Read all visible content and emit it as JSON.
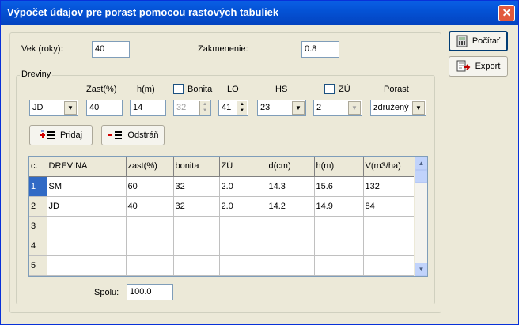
{
  "window": {
    "title": "Výpočet údajov pre porast pomocou rastových tabuliek",
    "close_label": "✕"
  },
  "top": {
    "vek_label": "Vek (roky):",
    "vek_value": "40",
    "zakmenenie_label": "Zakmenenie:",
    "zakmenenie_value": "0.8"
  },
  "dreviny": {
    "group_label": "Dreviny",
    "headers": {
      "zast": "Zast(%)",
      "h": "h(m)",
      "bonita": "Bonita",
      "lo": "LO",
      "hs": "HS",
      "zu": "ZÚ",
      "porast": "Porast"
    },
    "values": {
      "drevina": "JD",
      "zast": "40",
      "h": "14",
      "bonita": "32",
      "lo": "41",
      "hs": "23",
      "zu": "2",
      "porast": "združený"
    },
    "pridaj_label": "Pridaj",
    "odstran_label": "Odstráň"
  },
  "table": {
    "columns": [
      "c.",
      "DREVINA",
      "zast(%)",
      "bonita",
      "ZÚ",
      "d(cm)",
      "h(m)",
      "V(m3/ha)"
    ],
    "rows": [
      {
        "num": "1",
        "cells": [
          "SM",
          "60",
          "32",
          "2.0",
          "14.3",
          "15.6",
          "132"
        ]
      },
      {
        "num": "2",
        "cells": [
          "JD",
          "40",
          "32",
          "2.0",
          "14.2",
          "14.9",
          "84"
        ]
      },
      {
        "num": "3",
        "cells": [
          "",
          "",
          "",
          "",
          "",
          "",
          ""
        ]
      },
      {
        "num": "4",
        "cells": [
          "",
          "",
          "",
          "",
          "",
          "",
          ""
        ]
      },
      {
        "num": "5",
        "cells": [
          "",
          "",
          "",
          "",
          "",
          "",
          ""
        ]
      }
    ]
  },
  "spolu": {
    "label": "Spolu:",
    "value": "100.0"
  },
  "side": {
    "pocitat_label": "Počítať",
    "export_label": "Export"
  }
}
